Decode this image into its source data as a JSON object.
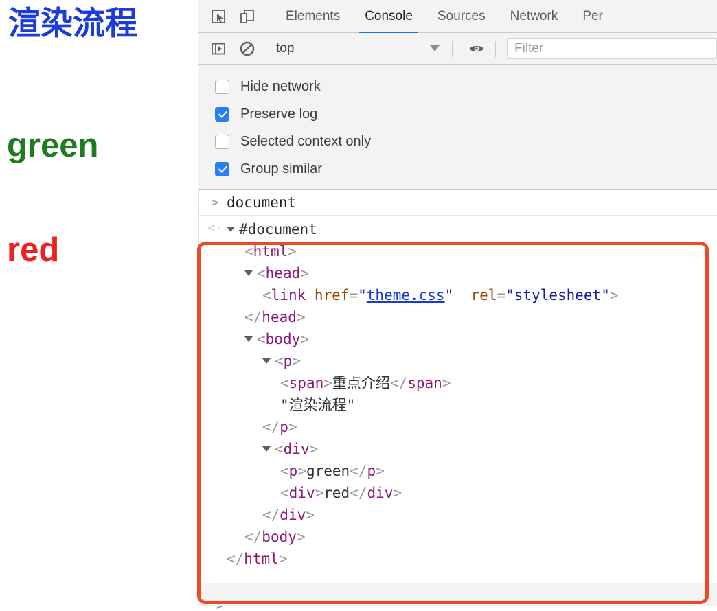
{
  "preview": {
    "heading": "渲染流程",
    "heading_color": "#1b3cd8",
    "green_text": "green",
    "green_color": "#1e7b1e",
    "red_text": "red",
    "red_color": "#ef2020"
  },
  "devtools": {
    "toolbar": {
      "inspect_icon": "inspect-element-icon",
      "device_icon": "device-toolbar-icon"
    },
    "tabs": [
      {
        "label": "Elements",
        "active": false
      },
      {
        "label": "Console",
        "active": true
      },
      {
        "label": "Sources",
        "active": false
      },
      {
        "label": "Network",
        "active": false
      },
      {
        "label": "Per",
        "active": false
      }
    ],
    "active_tab_underline_color": "#1a73e8",
    "filterbar": {
      "sidebar_icon": "console-sidebar-icon",
      "clear_icon": "clear-console-icon",
      "context_value": "top",
      "eye_icon": "live-expression-eye-icon",
      "filter_placeholder": "Filter",
      "filter_value": ""
    },
    "settings": [
      {
        "label": "Hide network",
        "checked": false
      },
      {
        "label": "Preserve log",
        "checked": true
      },
      {
        "label": "Selected context only",
        "checked": false
      },
      {
        "label": "Group similar",
        "checked": true
      }
    ],
    "checkbox_accent": "#2a7ef0",
    "console": {
      "prompt_symbol": ">",
      "expression": "document",
      "reply_symbol": "<·",
      "dom_tree": [
        {
          "indent": 0,
          "twisty": "open",
          "text": "#document"
        },
        {
          "indent": 1,
          "twisty": "none",
          "text": "<html>"
        },
        {
          "indent": 1,
          "twisty": "open",
          "text": "<head>"
        },
        {
          "indent": 2,
          "twisty": "none",
          "text": "<link href=\"theme.css\" rel=\"stylesheet\">"
        },
        {
          "indent": 1,
          "twisty": "none",
          "text": "</head>"
        },
        {
          "indent": 1,
          "twisty": "open",
          "text": "<body>"
        },
        {
          "indent": 2,
          "twisty": "open",
          "text": "<p>"
        },
        {
          "indent": 3,
          "twisty": "none",
          "text": "<span>重点介绍</span>"
        },
        {
          "indent": 3,
          "twisty": "none",
          "text": "\"渲染流程\""
        },
        {
          "indent": 2,
          "twisty": "none",
          "text": "</p>"
        },
        {
          "indent": 2,
          "twisty": "open",
          "text": "<div>"
        },
        {
          "indent": 3,
          "twisty": "none",
          "text": "<p>green</p>"
        },
        {
          "indent": 3,
          "twisty": "none",
          "text": "<div>red</div>"
        },
        {
          "indent": 2,
          "twisty": "none",
          "text": "</div>"
        },
        {
          "indent": 1,
          "twisty": "none",
          "text": "</body>"
        },
        {
          "indent": 0,
          "twisty": "none",
          "text": "</html>"
        }
      ]
    },
    "annotation": {
      "type": "highlight-rectangle",
      "color": "#ec4a25"
    },
    "bottom_prompt_symbol": ">"
  }
}
